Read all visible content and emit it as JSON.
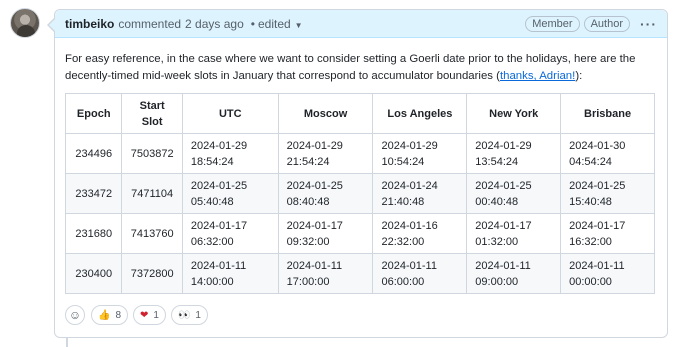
{
  "comment": {
    "author": "timbeiko",
    "action": "commented",
    "time": "2 days ago",
    "separator": "•",
    "edited": "edited",
    "badges": [
      "Member",
      "Author"
    ],
    "menu": "···",
    "paragraph_text": "For easy reference, in the case where we want to consider setting a Goerli date prior to the holidays, here are the decently-timed mid-week slots in January that correspond to accumulator boundaries (",
    "link_text": "thanks, Adrian!",
    "paragraph_end": "):"
  },
  "table": {
    "headers": [
      "Epoch",
      "Start Slot",
      "UTC",
      "Moscow",
      "Los Angeles",
      "New York",
      "Brisbane"
    ],
    "rows": [
      [
        "234496",
        "7503872",
        "2024-01-29 18:54:24",
        "2024-01-29 21:54:24",
        "2024-01-29 10:54:24",
        "2024-01-29 13:54:24",
        "2024-01-30 04:54:24"
      ],
      [
        "233472",
        "7471104",
        "2024-01-25 05:40:48",
        "2024-01-25 08:40:48",
        "2024-01-24 21:40:48",
        "2024-01-25 00:40:48",
        "2024-01-25 15:40:48"
      ],
      [
        "231680",
        "7413760",
        "2024-01-17 06:32:00",
        "2024-01-17 09:32:00",
        "2024-01-16 22:32:00",
        "2024-01-17 01:32:00",
        "2024-01-17 16:32:00"
      ],
      [
        "230400",
        "7372800",
        "2024-01-11 14:00:00",
        "2024-01-11 17:00:00",
        "2024-01-11 06:00:00",
        "2024-01-11 09:00:00",
        "2024-01-11 00:00:00"
      ]
    ]
  },
  "reactions": [
    {
      "icon": "thumbs-up-icon",
      "emoji": "👍",
      "count": "8"
    },
    {
      "icon": "heart-icon",
      "emoji": "❤",
      "count": "1"
    },
    {
      "icon": "eyes-icon",
      "emoji": "👀",
      "count": "1"
    }
  ],
  "add_reaction_icon": "smiley-icon",
  "colors": {
    "header_bg": "#ddf4ff",
    "link": "#0969da",
    "border": "#d0d7de"
  }
}
